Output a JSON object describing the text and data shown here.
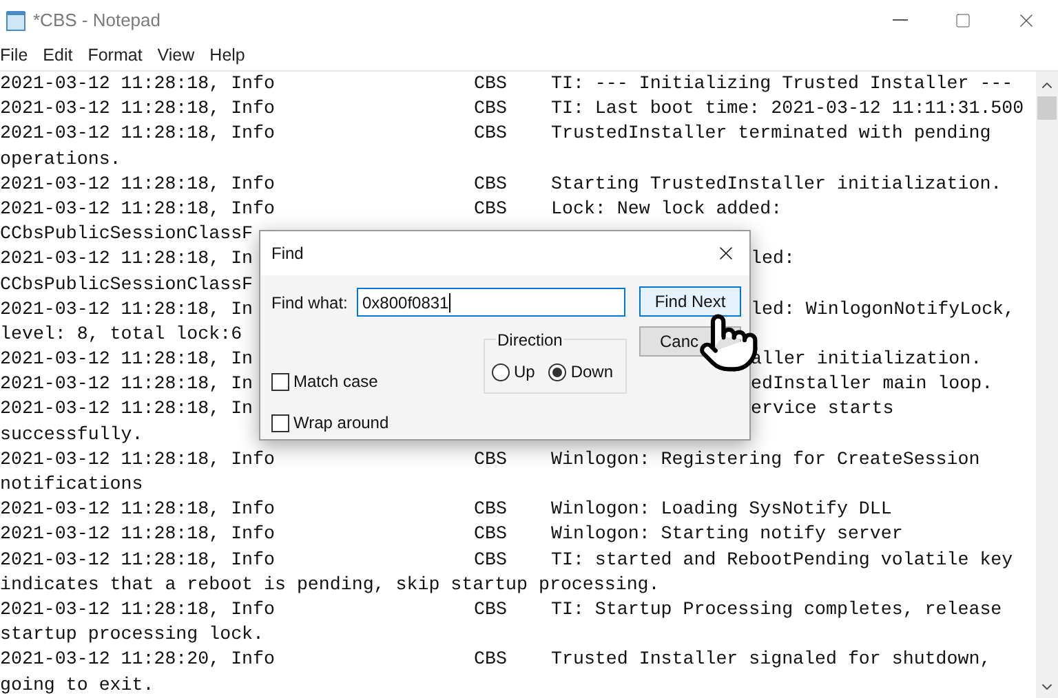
{
  "window": {
    "title": "*CBS - Notepad"
  },
  "menu": [
    "File",
    "Edit",
    "Format",
    "View",
    "Help"
  ],
  "lines": [
    {
      "kind": "entry",
      "time": "2021-03-12 11:28:18, Info",
      "source": "CBS",
      "message": "TI: --- Initializing Trusted Installer ---"
    },
    {
      "kind": "entry",
      "time": "2021-03-12 11:28:18, Info",
      "source": "CBS",
      "message": "TI: Last boot time: 2021-03-12 11:11:31.500"
    },
    {
      "kind": "entry",
      "time": "2021-03-12 11:28:18, Info",
      "source": "CBS",
      "message": "TrustedInstaller terminated with pending"
    },
    {
      "kind": "wrap",
      "text": "operations."
    },
    {
      "kind": "entry",
      "time": "2021-03-12 11:28:18, Info",
      "source": "CBS",
      "message": "Starting TrustedInstaller initialization."
    },
    {
      "kind": "entry",
      "time": "2021-03-12 11:28:18, Info",
      "source": "CBS",
      "message": "Lock: New lock added:"
    },
    {
      "kind": "covered",
      "left": "CCbsPublicSessionClassF"
    },
    {
      "kind": "covered",
      "left": "2021-03-12 11:28:18, In",
      "right": "led:"
    },
    {
      "kind": "covered",
      "left": "CCbsPublicSessionClassF"
    },
    {
      "kind": "covered",
      "left": "2021-03-12 11:28:18, In",
      "right": "led: WinlogonNotifyLock,"
    },
    {
      "kind": "wrap",
      "text": "level: 8, total lock:6"
    },
    {
      "kind": "covered",
      "left": "2021-03-12 11:28:18, In",
      "right": "aller initialization."
    },
    {
      "kind": "covered",
      "left": "2021-03-12 11:28:18, In",
      "right": "edInstaller main loop."
    },
    {
      "kind": "covered",
      "left": "2021-03-12 11:28:18, In",
      "right": "ervice starts"
    },
    {
      "kind": "wrap",
      "text": "successfully."
    },
    {
      "kind": "entry",
      "time": "2021-03-12 11:28:18, Info",
      "source": "CBS",
      "message": "Winlogon: Registering for CreateSession"
    },
    {
      "kind": "wrap",
      "text": "notifications"
    },
    {
      "kind": "entry",
      "time": "2021-03-12 11:28:18, Info",
      "source": "CBS",
      "message": "Winlogon: Loading SysNotify DLL"
    },
    {
      "kind": "entry",
      "time": "2021-03-12 11:28:18, Info",
      "source": "CBS",
      "message": "Winlogon: Starting notify server"
    },
    {
      "kind": "entry",
      "time": "2021-03-12 11:28:18, Info",
      "source": "CBS",
      "message": "TI: started and RebootPending volatile key"
    },
    {
      "kind": "wrap",
      "text": "indicates that a reboot is pending, skip startup processing."
    },
    {
      "kind": "entry",
      "time": "2021-03-12 11:28:18, Info",
      "source": "CBS",
      "message": "TI: Startup Processing completes, release"
    },
    {
      "kind": "wrap",
      "text": "startup processing lock."
    },
    {
      "kind": "entry",
      "time": "2021-03-12 11:28:20, Info",
      "source": "CBS",
      "message": "Trusted Installer signaled for shutdown,"
    },
    {
      "kind": "wrap",
      "text": "going to exit."
    }
  ],
  "find_dialog": {
    "title": "Find",
    "find_what_label": "Find what:",
    "find_what_value": "0x800f0831",
    "find_next_button": "Find Next",
    "cancel_button": "Canc",
    "direction": {
      "label": "Direction",
      "options": [
        {
          "label": "Up",
          "selected": false
        },
        {
          "label": "Down",
          "selected": true
        }
      ]
    },
    "checkboxes": [
      {
        "label": "Match case",
        "checked": false
      },
      {
        "label": "Wrap around",
        "checked": false
      }
    ]
  }
}
